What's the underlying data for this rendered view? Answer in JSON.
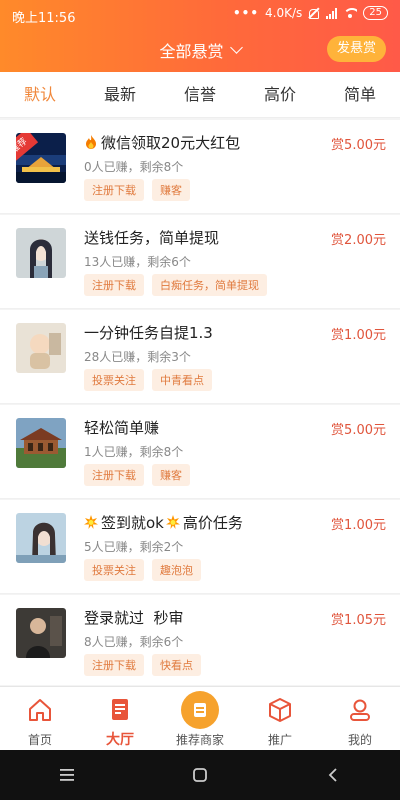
{
  "status": {
    "time": "晚上11:56",
    "dots": "•••",
    "speed": "4.0K/s",
    "battery": "25"
  },
  "header": {
    "title": "全部悬赏",
    "post_button": "发悬赏"
  },
  "tabs": [
    "默认",
    "最新",
    "信誉",
    "高价",
    "简单"
  ],
  "items": [
    {
      "title": "微信领取20元大红包",
      "meta": "0人已赚，剩余8个",
      "tags": [
        "注册下载",
        "赚客"
      ],
      "reward": "赏5.00元",
      "badge": "推荐"
    },
    {
      "title": "送钱任务，简单提现",
      "meta": "13人已赚，剩余6个",
      "tags": [
        "注册下载",
        "白痴任务，简单提现"
      ],
      "reward": "赏2.00元"
    },
    {
      "title": "一分钟任务自提1.3",
      "meta": "28人已赚，剩余3个",
      "tags": [
        "投票关注",
        "中青看点"
      ],
      "reward": "赏1.00元"
    },
    {
      "title": "轻松简单赚",
      "meta": "1人已赚，剩余8个",
      "tags": [
        "注册下载",
        "赚客"
      ],
      "reward": "赏5.00元"
    },
    {
      "title": "签到就ok",
      "title_suffix": "高价任务",
      "meta": "5人已赚，剩余2个",
      "tags": [
        "投票关注",
        "趣泡泡"
      ],
      "reward": "赏1.00元"
    },
    {
      "title": "登录就过  秒审",
      "meta": "8人已赚，剩余6个",
      "tags": [
        "注册下载",
        "快看点"
      ],
      "reward": "赏1.05元"
    }
  ],
  "bottom_nav": [
    {
      "label": "首页",
      "icon": "home-icon"
    },
    {
      "label": "大厅",
      "icon": "hall-icon",
      "active": true
    },
    {
      "label": "推荐商家",
      "icon": "recommend-merchant-icon"
    },
    {
      "label": "推广",
      "icon": "promote-box-icon"
    },
    {
      "label": "我的",
      "icon": "profile-icon"
    }
  ],
  "system_nav": [
    "menu-icon",
    "home-square-icon",
    "back-icon"
  ],
  "colors": {
    "accent": "#f0873a",
    "reward": "#e0553c",
    "header_start": "#ff8a2a",
    "header_end": "#ff5a48",
    "tag_bg": "#fdeee2"
  }
}
